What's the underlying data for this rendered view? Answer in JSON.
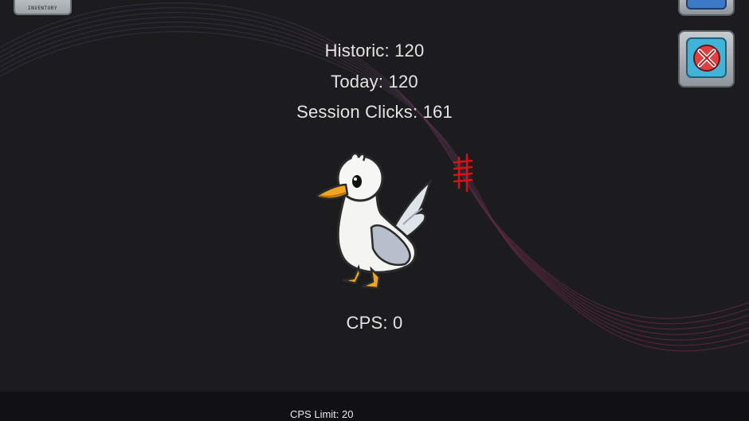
{
  "stats": {
    "historic": "Historic: 120",
    "today": "Today: 120",
    "session": "Session Clicks: 161",
    "cps": "CPS: 0"
  },
  "buttons": {
    "top_left_label": "INVENTORY",
    "top_right_icon": "menu-panel-icon",
    "close_icon": "close-x-icon"
  },
  "footer": {
    "cps_limit": "CPS Limit: 20"
  },
  "colors": {
    "background": "#1c1c1e",
    "footer": "#111113",
    "tally": "#d41414",
    "wave": "#7a2a48"
  }
}
